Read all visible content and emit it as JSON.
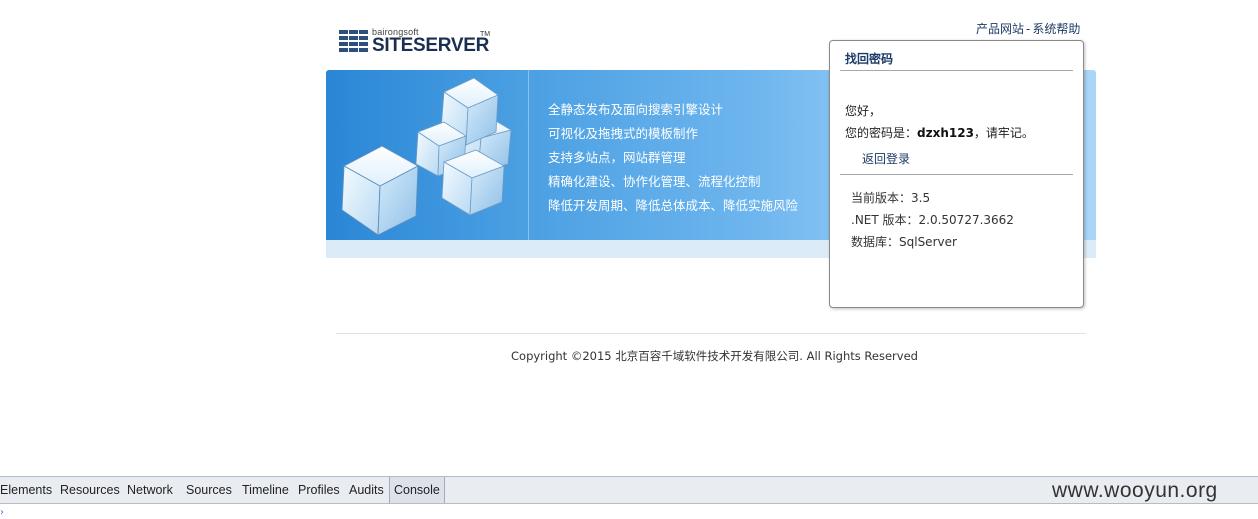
{
  "logo": {
    "small_text": "bairongsoft",
    "big_text": "SITESERVER",
    "tm": "TM"
  },
  "top_links": {
    "product_site": "产品网站",
    "separator": "-",
    "system_help": "系统帮助"
  },
  "banner": {
    "features": [
      "全静态发布及面向搜索引擎设计",
      "可视化及拖拽式的模板制作",
      "支持多站点，网站群管理",
      "精确化建设、协作化管理、流程化控制",
      "降低开发周期、降低总体成本、降低实施风险"
    ]
  },
  "panel": {
    "title": "找回密码",
    "greeting": "您好，",
    "password_prefix": "您的密码是：",
    "password": "dzxh123",
    "password_suffix": "，请牢记。",
    "back_link": "返回登录",
    "info": [
      "当前版本：3.5",
      ".NET 版本：2.0.50727.3662",
      "数据库：SqlServer"
    ]
  },
  "footer": {
    "copyright": "Copyright ©2015 北京百容千域软件技术开发有限公司. All Rights Reserved"
  },
  "devtools": {
    "tabs": [
      "Elements",
      "Resources",
      "Network",
      "Sources",
      "Timeline",
      "Profiles",
      "Audits",
      "Console"
    ],
    "active_tab": "Console",
    "watermark": "www.wooyun.org",
    "prompt_icon": "chevron-right-icon"
  },
  "colors": {
    "link": "#1c3b66",
    "banner_start": "#2a86d6",
    "banner_end": "#a9d6f8"
  }
}
